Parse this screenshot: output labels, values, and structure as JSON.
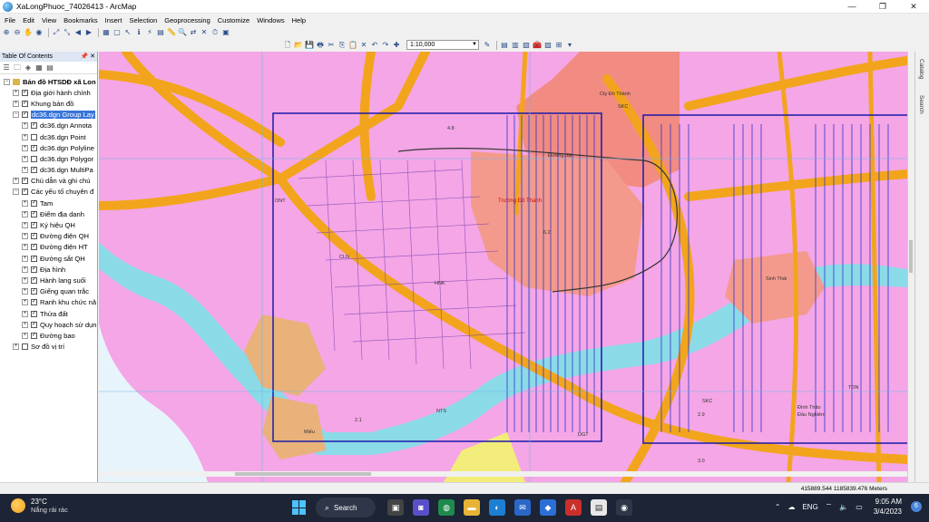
{
  "window": {
    "title": "XaLongPhuoc_74026413 - ArcMap",
    "controls": [
      "—",
      "❐",
      "✕"
    ]
  },
  "menu": [
    "File",
    "Edit",
    "View",
    "Bookmarks",
    "Insert",
    "Selection",
    "Geoprocessing",
    "Customize",
    "Windows",
    "Help"
  ],
  "toolbar": {
    "scale": "1:10,000"
  },
  "toc": {
    "title": "Table Of Contents",
    "header_buttons": "📌 ✕",
    "root": "Bản đồ HTSDĐ xã Lon",
    "items": [
      {
        "label": "Địa giới hành chính",
        "level": 1,
        "expander": "+",
        "checked": true
      },
      {
        "label": "Khung bản đồ",
        "level": 1,
        "expander": "+",
        "checked": true
      },
      {
        "label": "dc36.dgn Group Lay",
        "level": 1,
        "expander": "−",
        "checked": true,
        "selected": true
      },
      {
        "label": "dc36.dgn Annota",
        "level": 2,
        "expander": "+",
        "checked": true
      },
      {
        "label": "dc36.dgn Point",
        "level": 2,
        "expander": "+",
        "checked": false
      },
      {
        "label": "dc36.dgn Polyline",
        "level": 2,
        "expander": "+",
        "checked": true
      },
      {
        "label": "dc36.dgn Polygor",
        "level": 2,
        "expander": "+",
        "checked": false
      },
      {
        "label": "dc36.dgn MultiPa",
        "level": 2,
        "expander": "+",
        "checked": true
      },
      {
        "label": "Chú dẫn và ghi chú",
        "level": 1,
        "expander": "+",
        "checked": true
      },
      {
        "label": "Các yếu tố chuyên đ",
        "level": 1,
        "expander": "−",
        "checked": true
      },
      {
        "label": "Tam",
        "level": 2,
        "expander": "+",
        "checked": true
      },
      {
        "label": "Điểm địa danh",
        "level": 2,
        "expander": "+",
        "checked": true
      },
      {
        "label": "Ký hiệu QH",
        "level": 2,
        "expander": "+",
        "checked": true
      },
      {
        "label": "Đường điện QH",
        "level": 2,
        "expander": "+",
        "checked": true
      },
      {
        "label": "Đường điện HT",
        "level": 2,
        "expander": "+",
        "checked": true
      },
      {
        "label": "Đường sắt QH",
        "level": 2,
        "expander": "+",
        "checked": true
      },
      {
        "label": "Địa hình",
        "level": 2,
        "expander": "+",
        "checked": true
      },
      {
        "label": "Hành lang suối",
        "level": 2,
        "expander": "+",
        "checked": true
      },
      {
        "label": "Giếng quan trắc",
        "level": 2,
        "expander": "+",
        "checked": true
      },
      {
        "label": "Ranh khu chức nă",
        "level": 2,
        "expander": "+",
        "checked": true
      },
      {
        "label": "Thửa đất",
        "level": 2,
        "expander": "+",
        "checked": true
      },
      {
        "label": "Quy hoạch sử dụn",
        "level": 2,
        "expander": "+",
        "checked": true
      },
      {
        "label": "Đường bao",
        "level": 2,
        "expander": "+",
        "checked": true
      },
      {
        "label": "Sơ đồ vị trí",
        "level": 1,
        "expander": "+",
        "checked": false
      }
    ]
  },
  "map": {
    "labels": [
      {
        "text": "Cty Đồ Thành",
        "class": ""
      },
      {
        "text": "SKC",
        "class": ""
      },
      {
        "text": "ONT",
        "class": ""
      },
      {
        "text": "CLN",
        "class": ""
      },
      {
        "text": "HNK",
        "class": ""
      },
      {
        "text": "NTS",
        "class": ""
      },
      {
        "text": "DGT",
        "class": ""
      },
      {
        "text": "TON",
        "class": ""
      },
      {
        "text": "SKC",
        "class": ""
      },
      {
        "text": "Đường đặt",
        "class": ""
      },
      {
        "text": "Sinh Thái",
        "class": ""
      },
      {
        "text": "Đình Thảo",
        "class": ""
      },
      {
        "text": "Đầu Nghiêm",
        "class": ""
      },
      {
        "text": "Miếu",
        "class": ""
      },
      {
        "text": "Trường Đô Thành",
        "class": "red"
      },
      {
        "text": "4.8",
        "class": ""
      },
      {
        "text": "6.2",
        "class": ""
      },
      {
        "text": "2.1",
        "class": ""
      },
      {
        "text": "3.0",
        "class": ""
      },
      {
        "text": "2.9",
        "class": ""
      }
    ]
  },
  "side_tabs": [
    "Catalog",
    "Search"
  ],
  "status": {
    "coords": "415889.544  1185839.476 Meters"
  },
  "taskbar": {
    "weather_temp": "23°C",
    "weather_desc": "Nắng rải rác",
    "search": "Search",
    "lang": "ENG",
    "time": "9:05 AM",
    "date": "3/4/2023",
    "notification_count": "6"
  }
}
